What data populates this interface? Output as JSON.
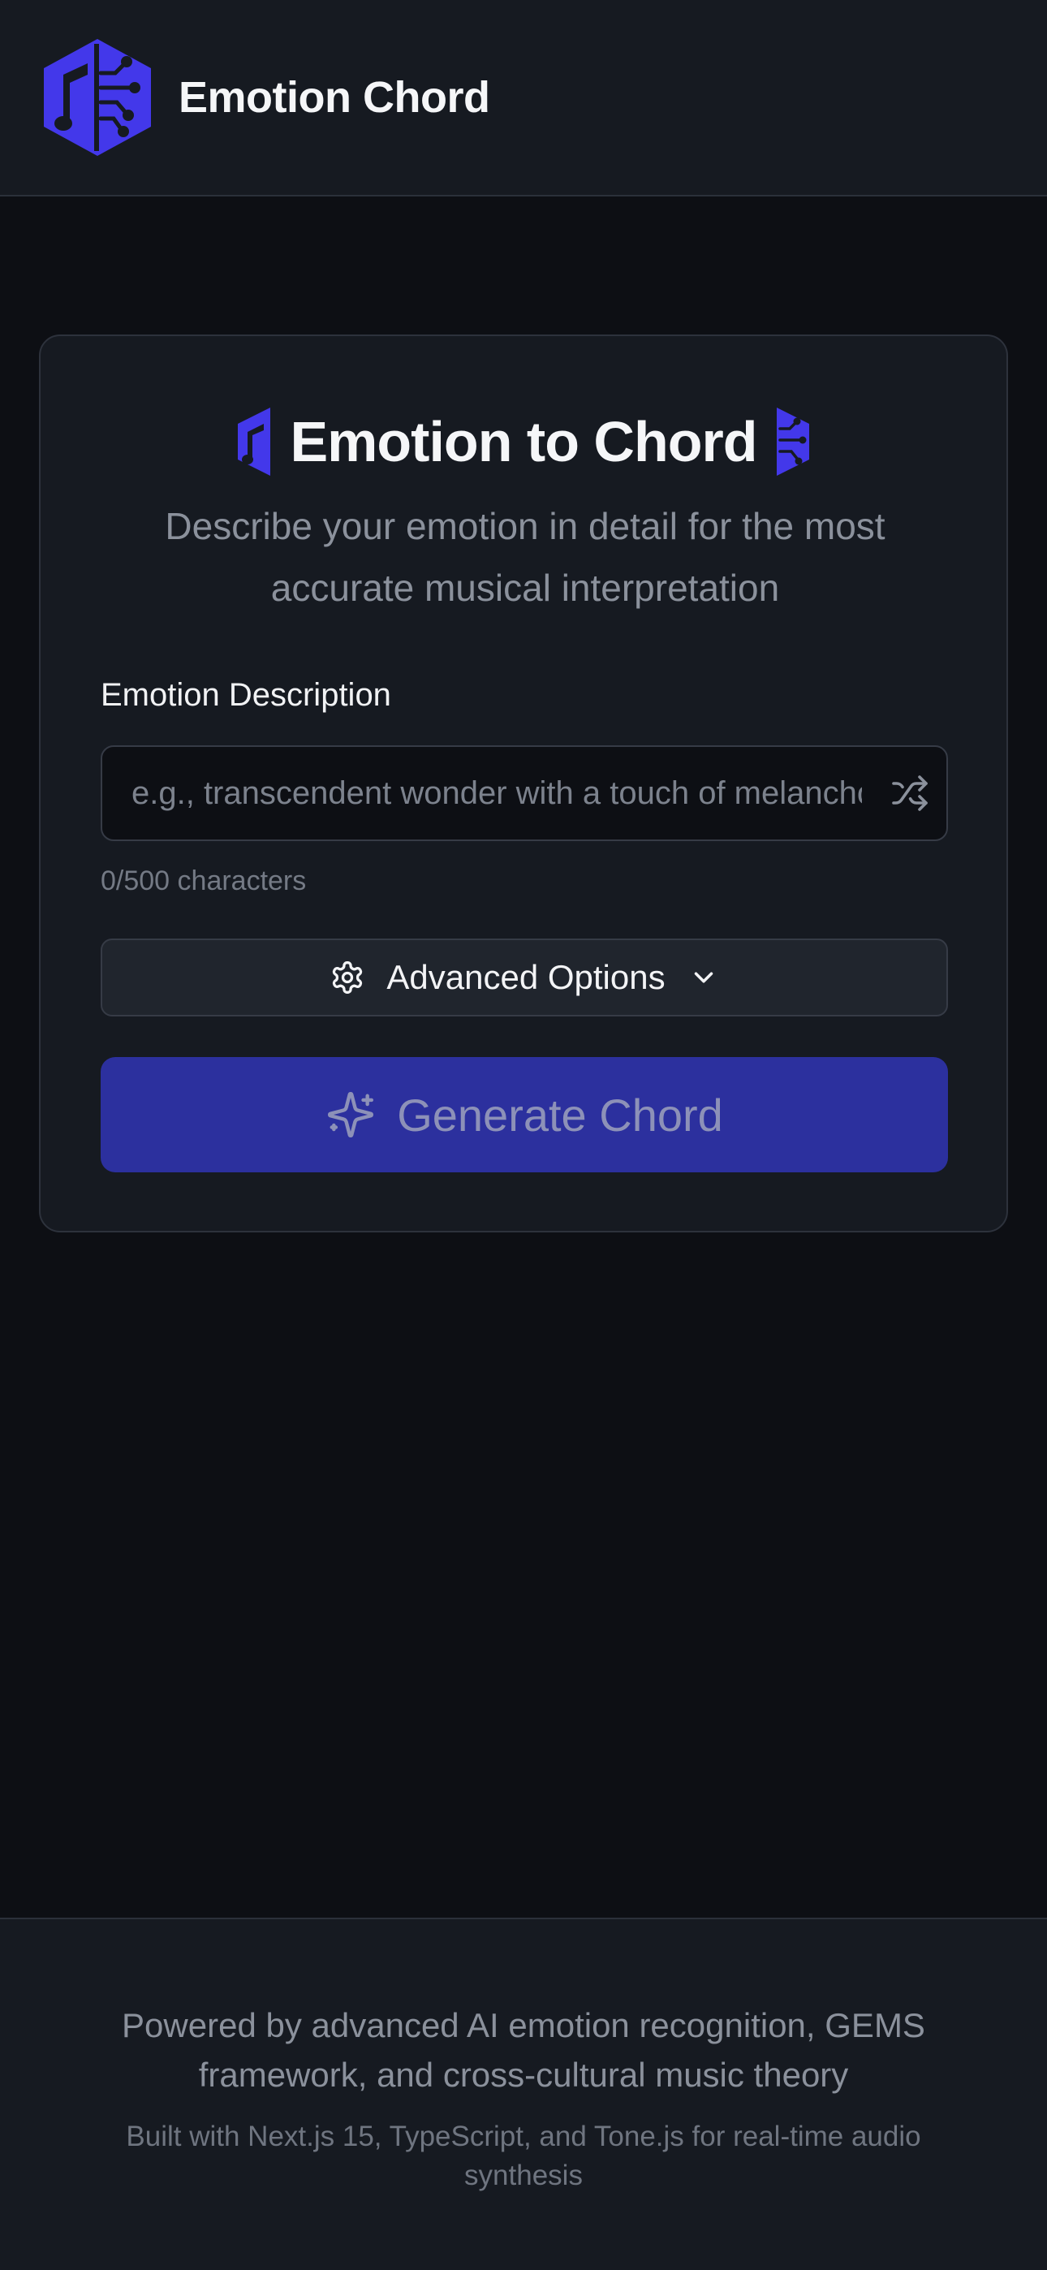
{
  "header": {
    "app_title": "Emotion Chord",
    "logo_icon": "music-note-circuit-hexagon-icon"
  },
  "card": {
    "title": "Emotion to Chord",
    "subtitle": "Describe your emotion in detail for the most accurate musical interpretation",
    "emotion_field": {
      "label": "Emotion Description",
      "value": "",
      "placeholder": "e.g., transcendent wonder with a touch of melancholy",
      "shuffle_icon": "shuffle-icon"
    },
    "char_count": "0/500 characters",
    "advanced_options": {
      "label": "Advanced Options",
      "icon": "gear-icon",
      "chevron": "chevron-down-icon"
    },
    "generate_button": {
      "label": "Generate Chord",
      "icon": "sparkles-icon",
      "disabled": true
    }
  },
  "footer": {
    "main_text": "Powered by advanced AI emotion recognition, GEMS framework, and cross-cultural music theory",
    "sub_text": "Built with Next.js 15, TypeScript, and Tone.js for real-time audio synthesis"
  },
  "colors": {
    "brand": "#4338ea",
    "background": "#0d0f14",
    "surface": "#161a21",
    "generate_button_bg": "#2c309e"
  }
}
